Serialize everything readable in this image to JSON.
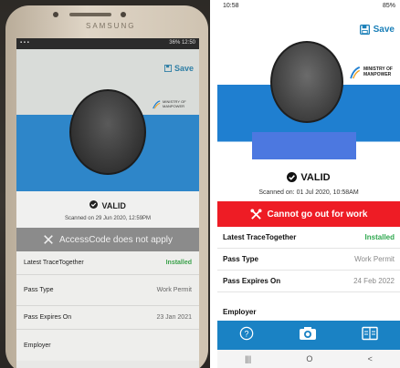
{
  "left_photo": {
    "brand": "SAMSUNG",
    "status_right": "36% 12:50",
    "save_label": "Save",
    "mom_text": "MINISTRY OF MANPOWER",
    "holder_name": "",
    "valid_label": "VALID",
    "scanned_text": "Scanned on 29 Jun 2020, 12:59PM",
    "banner_text": "AccessCode does not apply",
    "rows": [
      {
        "label": "Latest TraceTogether",
        "value": "Installed"
      },
      {
        "label": "Pass Type",
        "value": "Work Permit"
      },
      {
        "label": "Pass Expires On",
        "value": "23 Jan 2021"
      },
      {
        "label": "Employer",
        "value": ""
      }
    ]
  },
  "screenshot": {
    "status_time": "10:58",
    "status_right": "85%",
    "save_label": "Save",
    "mom_text": "MINISTRY OF MANPOWER",
    "valid_label": "VALID",
    "scanned_text": "Scanned on: 01 Jul 2020, 10:58AM",
    "banner_text": "Cannot go out for work",
    "rows": [
      {
        "label": "Latest TraceTogether",
        "value": "Installed"
      },
      {
        "label": "Pass Type",
        "value": "Work Permit"
      },
      {
        "label": "Pass Expires On",
        "value": "24 Feb 2022"
      },
      {
        "label": "Employer",
        "value": ""
      }
    ],
    "nav_icons": [
      "help-icon",
      "camera-icon",
      "card-icon"
    ],
    "sys_nav": [
      "|||",
      "O",
      "<"
    ]
  },
  "colors": {
    "accent_blue": "#1f7fd0",
    "banner_red": "#ee1c25",
    "installed_green": "#2fa84f",
    "navbar_blue": "#1a82c4"
  }
}
